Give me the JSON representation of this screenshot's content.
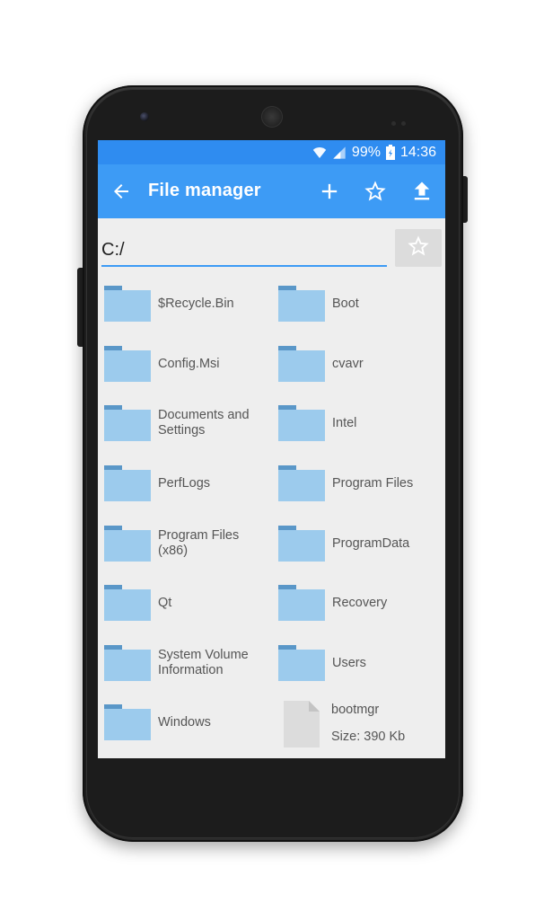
{
  "status_bar": {
    "battery": "99%",
    "time": "14:36"
  },
  "app_bar": {
    "title": "File manager",
    "icons": [
      "arrow-back-icon",
      "plus-icon",
      "star-outline-icon",
      "upload-icon"
    ]
  },
  "path_bar": {
    "value": "C:/"
  },
  "colors": {
    "status_bar": "#2f8cf0",
    "app_bar": "#3d9bf5",
    "folder": "#9ccbed",
    "folder_tab": "#5a97c8",
    "background": "#eeeeee"
  },
  "folders": [
    {
      "name": "$Recycle.Bin"
    },
    {
      "name": "Boot"
    },
    {
      "name": "Config.Msi"
    },
    {
      "name": "cvavr"
    },
    {
      "name": "Documents and Settings"
    },
    {
      "name": "Intel"
    },
    {
      "name": "PerfLogs"
    },
    {
      "name": "Program Files"
    },
    {
      "name": "Program Files (x86)"
    },
    {
      "name": "ProgramData"
    },
    {
      "name": "Qt"
    },
    {
      "name": "Recovery"
    },
    {
      "name": "System Volume Information"
    },
    {
      "name": "Users"
    },
    {
      "name": "Windows"
    }
  ],
  "files": [
    {
      "name": "bootmgr",
      "size": "Size: 390 Kb"
    }
  ]
}
